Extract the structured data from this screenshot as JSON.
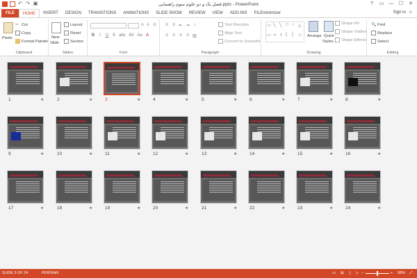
{
  "window": {
    "title": "فصل یک و دو علوم سوم راهنمایی.pptx - PowerPoint",
    "controls": [
      "?",
      "▭",
      "—",
      "☐",
      "✕"
    ]
  },
  "tabs": [
    "FILE",
    "HOME",
    "INSERT",
    "DESIGN",
    "TRANSITIONS",
    "ANIMATIONS",
    "SLIDE SHOW",
    "REVIEW",
    "VIEW",
    "ADD-INS",
    "FILEminimizer"
  ],
  "active_tab": "HOME",
  "account": {
    "signin": "Sign in"
  },
  "ribbon": {
    "clipboard": {
      "label": "Clipboard",
      "paste": "Paste",
      "cut": "Cut",
      "copy": "Copy",
      "format_painter": "Format Painter"
    },
    "slides": {
      "label": "Slides",
      "new_slide": "New",
      "new_slide2": "Slide",
      "layout": "Layout",
      "reset": "Reset",
      "section": "Section"
    },
    "font": {
      "label": "Font",
      "bold": "B",
      "italic": "I",
      "underline": "U",
      "shadow": "S",
      "strike": "abc",
      "spacing": "AV",
      "case": "Aa",
      "color": "A"
    },
    "paragraph": {
      "label": "Paragraph",
      "text_direction": "Text Direction",
      "align_text": "Align Text",
      "convert_smartart": "Convert to SmartArt"
    },
    "drawing": {
      "label": "Drawing",
      "arrange": "Arrange",
      "quick_styles": "Quick",
      "quick_styles2": "Styles",
      "shape_fill": "Shape Fill",
      "shape_outline": "Shape Outline",
      "shape_effects": "Shape Effects"
    },
    "editing": {
      "label": "Editing",
      "find": "Find",
      "replace": "Replace",
      "select": "Select"
    }
  },
  "slides": [
    {
      "number": "1",
      "star": "★"
    },
    {
      "number": "2",
      "star": "★"
    },
    {
      "number": "3",
      "star": "★"
    },
    {
      "number": "4",
      "star": "★"
    },
    {
      "number": "5",
      "star": "★"
    },
    {
      "number": "6",
      "star": "★"
    },
    {
      "number": "7",
      "star": "★"
    },
    {
      "number": "8",
      "star": "★"
    },
    {
      "number": "9",
      "star": "★"
    },
    {
      "number": "10",
      "star": "★"
    },
    {
      "number": "11",
      "star": "★"
    },
    {
      "number": "12",
      "star": "★"
    },
    {
      "number": "13",
      "star": "★"
    },
    {
      "number": "14",
      "star": "★"
    },
    {
      "number": "15",
      "star": "★"
    },
    {
      "number": "16",
      "star": "★"
    },
    {
      "number": "17",
      "star": "★"
    },
    {
      "number": "18",
      "star": "★"
    },
    {
      "number": "19",
      "star": "★"
    },
    {
      "number": "20",
      "star": "★"
    },
    {
      "number": "21",
      "star": "★"
    },
    {
      "number": "22",
      "star": "★"
    },
    {
      "number": "23",
      "star": "★"
    },
    {
      "number": "24",
      "star": "★"
    }
  ],
  "selected_slide": "3",
  "status": {
    "slide_info": "SLIDE 3 OF 24",
    "language": "PERSIAN",
    "zoom": "58%",
    "zoom_minus": "−",
    "zoom_plus": "+"
  },
  "colors": {
    "accent": "#d24726",
    "slide_bg": "#6e6e6e",
    "slide_header": "#8c2c3a"
  }
}
